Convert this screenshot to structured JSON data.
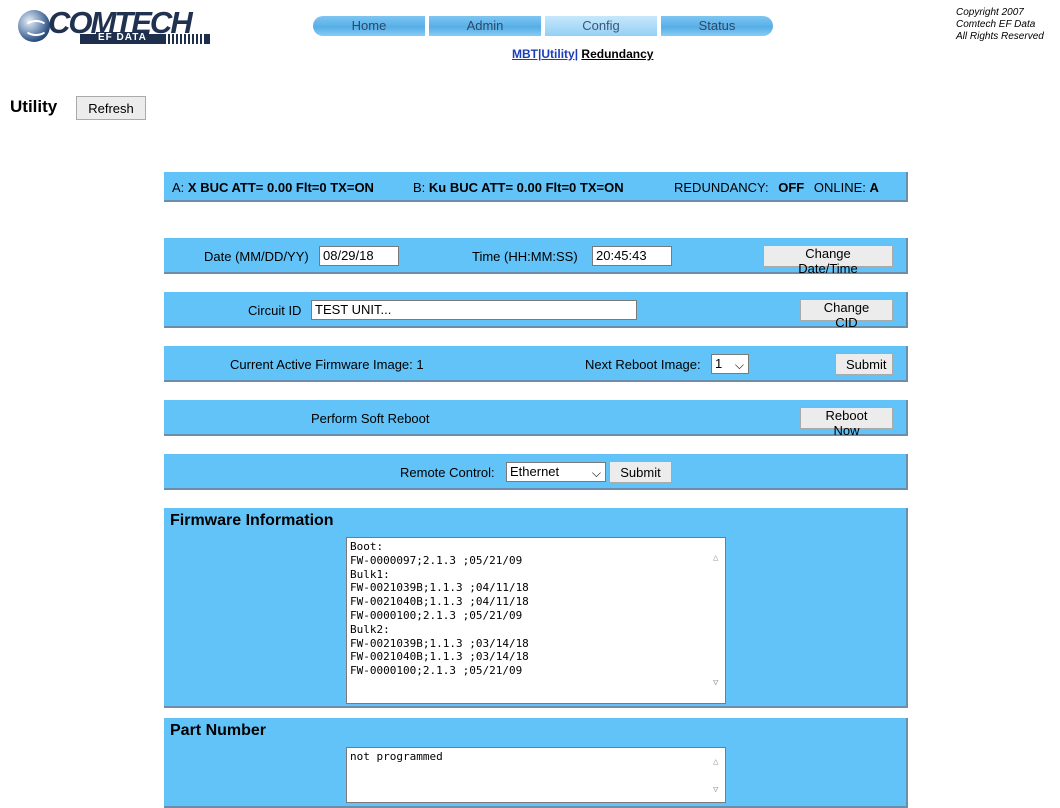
{
  "logo": {
    "name": "COMTECH",
    "sub": "EF DATA"
  },
  "nav": {
    "tabs": [
      "Home",
      "Admin",
      "Config",
      "Status"
    ]
  },
  "subnav": {
    "mbt": "MBT|",
    "utility": "Utility|",
    "redundancy": "Redundancy"
  },
  "copyright": [
    "Copyright 2007",
    "Comtech EF Data",
    "All Rights Reserved"
  ],
  "page": {
    "title": "Utility",
    "refresh": "Refresh"
  },
  "status": {
    "a_prefix": "A:",
    "a_value": "X BUC ATT= 0.00 Flt=0 TX=ON",
    "b_prefix": "B:",
    "b_value": "Ku BUC ATT= 0.00 Flt=0 TX=ON",
    "redundancy_label": "REDUNDANCY:",
    "redundancy_value": "OFF",
    "online_label": "ONLINE:",
    "online_value": "A"
  },
  "datetime": {
    "date_label": "Date (MM/DD/YY)",
    "date_value": "08/29/18",
    "time_label": "Time (HH:MM:SS)",
    "time_value": "20:45:43",
    "button": "Change Date/Time"
  },
  "circuit": {
    "label": "Circuit ID",
    "value": "TEST UNIT...",
    "button": "Change CID"
  },
  "firmware_image": {
    "label": "Current Active Firmware Image: 1",
    "next_label": "Next Reboot Image:",
    "next_value": "1",
    "button": "Submit"
  },
  "reboot": {
    "label": "Perform Soft Reboot",
    "button": "Reboot Now"
  },
  "remote": {
    "label": "Remote Control:",
    "value": "Ethernet",
    "button": "Submit"
  },
  "firmware_info": {
    "title": "Firmware Information",
    "content": "Boot:\nFW-0000097;2.1.3 ;05/21/09\nBulk1:\nFW-0021039B;1.1.3 ;04/11/18\nFW-0021040B;1.1.3 ;04/11/18\nFW-0000100;2.1.3 ;05/21/09\nBulk2:\nFW-0021039B;1.1.3 ;03/14/18\nFW-0021040B;1.1.3 ;03/14/18\nFW-0000100;2.1.3 ;05/21/09"
  },
  "part_number": {
    "title": "Part Number",
    "content": "not programmed"
  },
  "colors": {
    "panel": "#61c3f8",
    "panel_border": "#6f8ca8",
    "nav": "#56aee6",
    "link": "#1a3dba",
    "logo": "#20324f"
  },
  "icons": [
    "comtech-logo",
    "chevron-down-icon",
    "scroll-up-arrow-icon",
    "scroll-down-arrow-icon"
  ]
}
